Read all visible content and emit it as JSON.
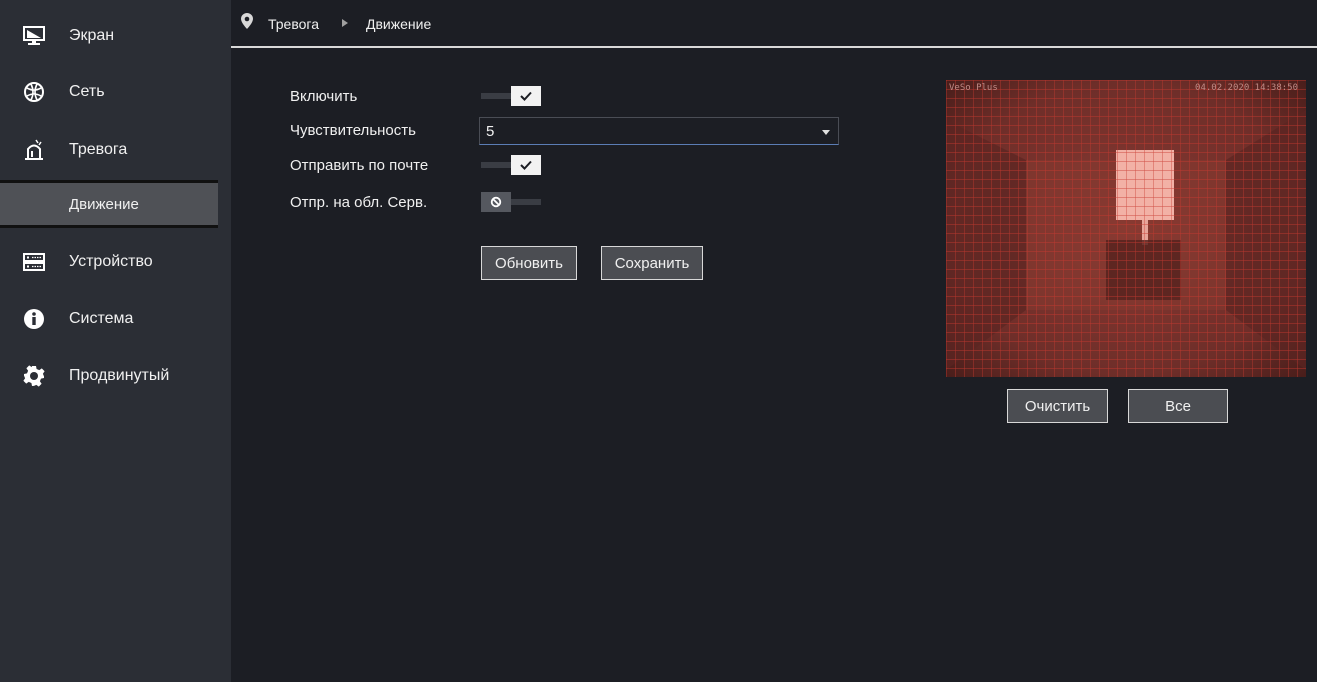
{
  "sidebar": {
    "items": [
      {
        "label": "Экран",
        "icon": "monitor-icon"
      },
      {
        "label": "Сеть",
        "icon": "network-globe-icon"
      },
      {
        "label": "Тревога",
        "icon": "alarm-siren-icon"
      },
      {
        "label": "Движение"
      },
      {
        "label": "Устройство",
        "icon": "storage-device-icon"
      },
      {
        "label": "Система",
        "icon": "info-icon"
      },
      {
        "label": "Продвинутый",
        "icon": "gear-icon"
      }
    ]
  },
  "breadcrumb": {
    "icon": "location-pin-icon",
    "level1": "Тревога",
    "level2": "Движение"
  },
  "form": {
    "enable": {
      "label": "Включить",
      "value": true
    },
    "sensitivity": {
      "label": "Чувствительность",
      "value": "5"
    },
    "send_mail": {
      "label": "Отправить по почте",
      "value": true
    },
    "cloud": {
      "label": "Отпр. на обл. Серв.",
      "value": false
    },
    "refresh_label": "Обновить",
    "save_label": "Сохранить"
  },
  "preview": {
    "overlay_left": "VeSo Plus",
    "overlay_right": "04.02.2020 14:38:50",
    "clear_label": "Очистить",
    "all_label": "Все"
  },
  "colors": {
    "sidebar_bg": "#2b2e35",
    "content_bg": "#1c1e24",
    "active_item": "#4f5156",
    "grid_red": "#c0322a"
  }
}
